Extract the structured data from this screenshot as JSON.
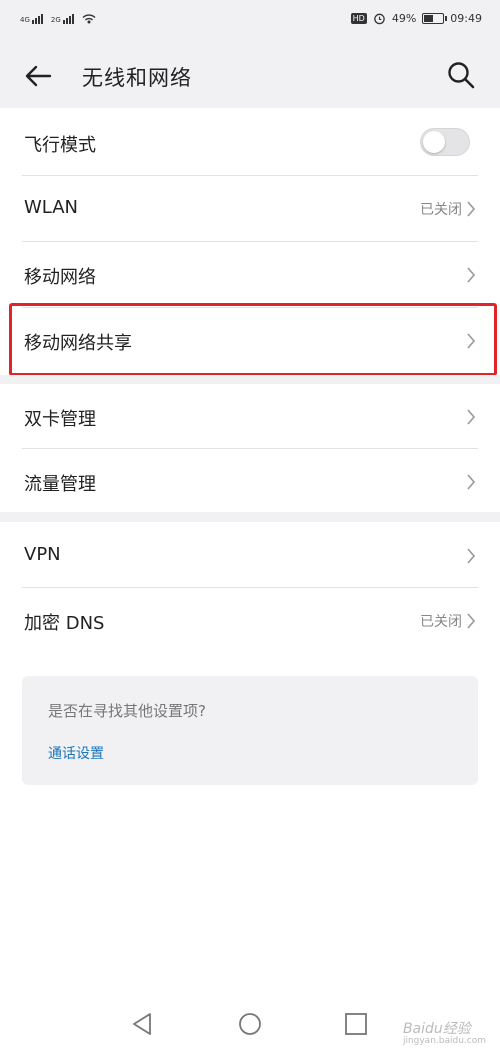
{
  "status_bar": {
    "sim1": "4G",
    "sim2": "2G",
    "hd": "HD",
    "battery": "49%",
    "battery_level": 0.49,
    "time": "09:49"
  },
  "header": {
    "title": "无线和网络"
  },
  "settings": {
    "airplane": {
      "label": "飞行模式",
      "enabled": false
    },
    "wlan": {
      "label": "WLAN",
      "value": "已关闭"
    },
    "mobile_network": {
      "label": "移动网络"
    },
    "tethering": {
      "label": "移动网络共享"
    },
    "dual_sim": {
      "label": "双卡管理"
    },
    "data_usage": {
      "label": "流量管理"
    },
    "vpn": {
      "label": "VPN"
    },
    "private_dns": {
      "label": "加密 DNS",
      "value": "已关闭"
    }
  },
  "suggest": {
    "question": "是否在寻找其他设置项?",
    "link": "通话设置"
  },
  "watermark": {
    "brand": "Baidu经验",
    "domain": "jingyan.baidu.com"
  },
  "colors": {
    "highlight": "#e1232a",
    "link": "#1a76b8",
    "background_gray": "#f1f0f3"
  }
}
